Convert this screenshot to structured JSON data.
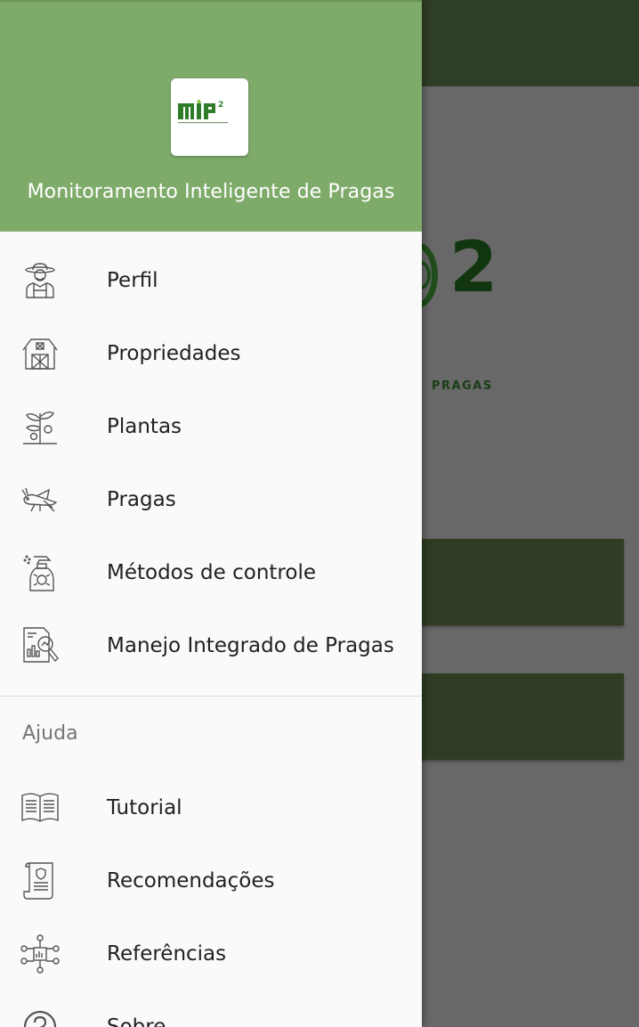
{
  "app": {
    "title": "Monitoramento Inteligente de Pragas",
    "logo_icon": "mip2-logo"
  },
  "background": {
    "logo_subtitle": "PRAGAS",
    "logo_number": "2"
  },
  "menu": {
    "items": [
      {
        "label": "Perfil",
        "icon": "farmer-icon"
      },
      {
        "label": "Propriedades",
        "icon": "barn-icon"
      },
      {
        "label": "Plantas",
        "icon": "plant-icon"
      },
      {
        "label": "Pragas",
        "icon": "grasshopper-icon"
      },
      {
        "label": "Métodos de controle",
        "icon": "spray-bottle-icon"
      },
      {
        "label": "Manejo Integrado de Pragas",
        "icon": "report-analysis-icon"
      }
    ],
    "help_section": {
      "label": "Ajuda",
      "items": [
        {
          "label": "Tutorial",
          "icon": "book-icon"
        },
        {
          "label": "Recomendações",
          "icon": "document-scroll-icon"
        },
        {
          "label": "Referências",
          "icon": "network-chart-icon"
        },
        {
          "label": "Sobre",
          "icon": "help-circle-icon"
        }
      ]
    }
  },
  "colors": {
    "header": "#7fab6a",
    "toolbar_dimmed": "#2f3e27",
    "logo_green": "#2f7d2a"
  }
}
